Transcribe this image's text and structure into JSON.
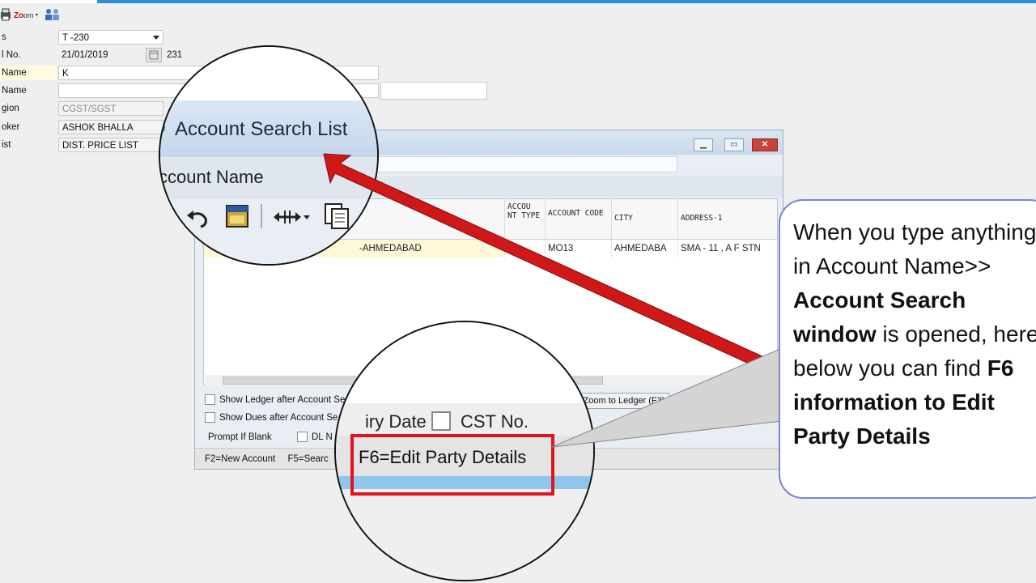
{
  "form": {
    "rows": [
      {
        "label": "s",
        "value": "T  -230"
      },
      {
        "label": "l No.",
        "value": "21/01/2019",
        "extra": "231"
      },
      {
        "label": "Name",
        "value": "K"
      },
      {
        "label": "Name",
        "value": ""
      },
      {
        "label": "gion",
        "value": "CGST/SGST"
      },
      {
        "label": "oker",
        "value": "ASHOK BHALLA"
      },
      {
        "label": "ist",
        "value": "DIST. PRICE LIST"
      }
    ]
  },
  "dialog": {
    "title": "Account Search List",
    "search_label": "ccount Name",
    "columns": [
      {
        "label": "ACCOU NT TYPE"
      },
      {
        "label": "ACCOUNT CODE"
      },
      {
        "label": "CITY"
      },
      {
        "label": "ADDRESS-1"
      }
    ],
    "row": {
      "name": "-AHMEDABAD",
      "type": "",
      "code": "MO13",
      "city": "AHMEDABA",
      "address": "SMA - 11 , A F STN"
    },
    "checkboxes": {
      "show_ledger": "Show Ledger after Account Se",
      "show_dues": "Show Dues after Account Se",
      "prompt_blank": "Prompt If Blank",
      "dl_no": "DL N"
    },
    "buttons": {
      "zoom_ledger": "Zoom to Ledger (F3)",
      "zoom_other": "Z"
    },
    "status": {
      "f2": "F2=New Account",
      "f5": "F5=Searc"
    }
  },
  "magnifier2": {
    "expiry_fragment": "iry Date",
    "cst_label": "CST No.",
    "f6_label": "F6=Edit Party Details"
  },
  "callout": {
    "line1": "When you type anything in Account Name>> ",
    "bold1": "Account Search window",
    "line2": " is opened, here below you can find ",
    "bold2": "F6 information to Edit Party Details"
  },
  "colors": {
    "accent_blue": "#2a8fd8",
    "arrow_red": "#d01818",
    "highlight_red": "#e0141c",
    "callout_border": "#7a86c9"
  }
}
